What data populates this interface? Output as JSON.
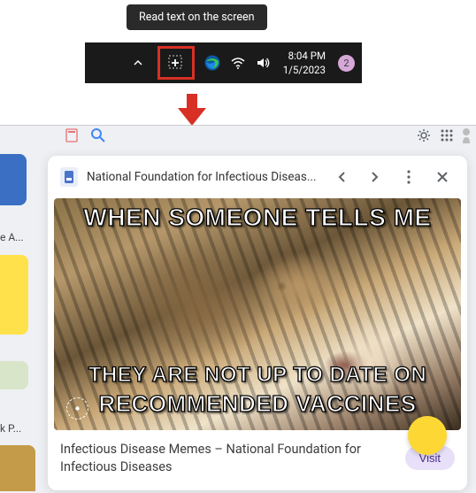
{
  "tooltip": {
    "text": "Read text on the screen"
  },
  "taskbar": {
    "time": "8:04 PM",
    "date": "1/5/2023",
    "notification_count": "2"
  },
  "browser": {
    "side_labels": {
      "a": "e A...",
      "kp": "k P..."
    }
  },
  "card": {
    "source": "National Foundation for Infectious Diseas...",
    "meme": {
      "top": "WHEN SOMEONE TELLS ME",
      "mid": "THEY ARE NOT UP TO DATE ON",
      "bot": "RECOMMENDED VACCINES"
    },
    "caption": "Infectious Disease Memes – National Foundation for Infectious Diseases",
    "visit_label": "Visit"
  }
}
